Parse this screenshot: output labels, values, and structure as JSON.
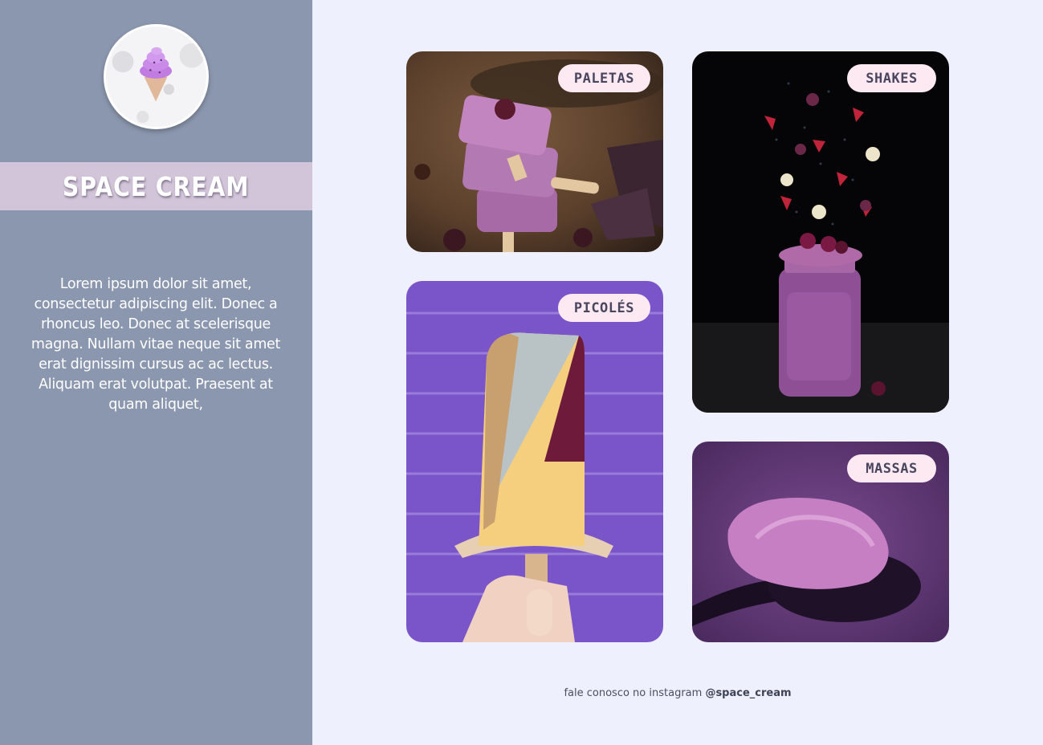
{
  "sidebar": {
    "logo": "ice-cream-cone-icon",
    "brand": "SPACE CREAM",
    "description": "Lorem ipsum dolor sit amet, consectetur adipiscing elit. Donec a rhoncus leo. Donec at scelerisque magna. Nullam vitae neque sit amet erat dignissim cursus ac ac lectus. Aliquam erat volutpat. Praesent at quam aliquet,"
  },
  "gallery": {
    "paletas": {
      "label": "PALETAS"
    },
    "shakes": {
      "label": "SHAKES"
    },
    "picoles": {
      "label": "PICOLÉS"
    },
    "massas": {
      "label": "MASSAS"
    }
  },
  "footer": {
    "text": "fale conosco no instagram ",
    "handle": "@space_cream"
  },
  "colors": {
    "sidebar_bg": "#8b97ae",
    "band_bg": "#d2c5d9",
    "page_bg": "#eff0fd",
    "pill_bg": "#fde9f2",
    "pill_text": "#4a4660"
  }
}
